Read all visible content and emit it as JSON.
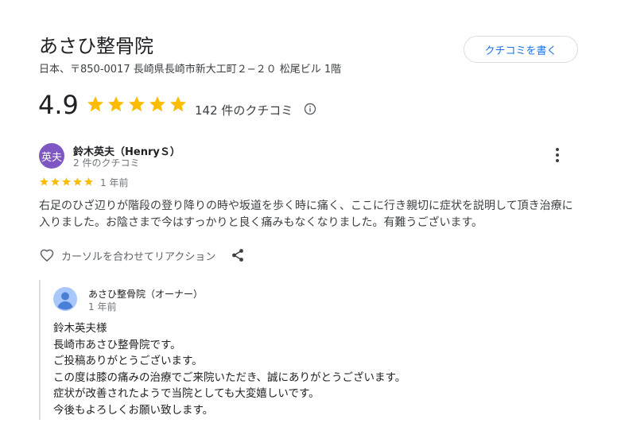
{
  "business": {
    "name": "あさひ整骨院",
    "address": "日本、〒850-0017 長崎県長崎市新大工町２−２０ 松尾ビル 1階",
    "write_review_label": "クチコミを書く",
    "rating": "4.9",
    "rating_value": 4.9,
    "review_count_label": "142 件のクチコミ",
    "star_color": "#fbbc04"
  },
  "review": {
    "avatar_text": "英夫",
    "avatar_color": "#7e57c2",
    "reviewer_name": "鈴木英夫（HenryＳ）",
    "reviewer_reviews": "2 件のクチコミ",
    "stars": 5,
    "date": "1 年前",
    "text": "右足のひざ辺りが階段の登り降りの時や坂道を歩く時に痛く、ここに行き親切に症状を説明して頂き治療に入りました。お陰さまで今はすっかりと良く痛みもなくなりました。有難うございます。",
    "react_label": "カーソルを合わせてリアクション"
  },
  "owner_reply": {
    "name": "あさひ整骨院（オーナー）",
    "date": "1 年前",
    "lines": [
      "鈴木英夫様",
      "長崎市あさひ整骨院です。",
      "ご投稿ありがとうございます。",
      "この度は膝の痛みの治療でご来院いただき、誠にありがとうございます。",
      "症状が改善されたようで当院としても大変嬉しいです。",
      "今後もよろしくお願い致します。"
    ]
  }
}
